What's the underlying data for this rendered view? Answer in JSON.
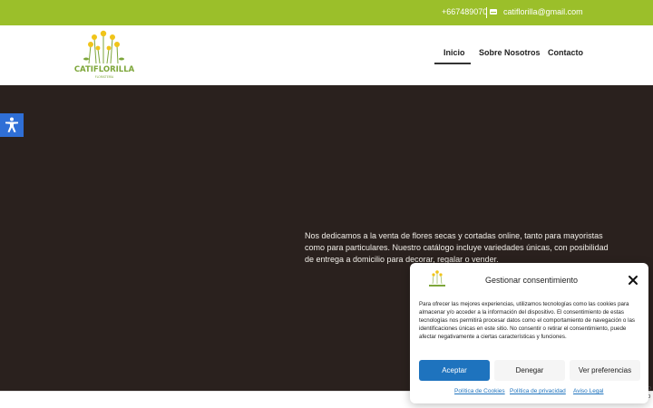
{
  "topbar": {
    "phone": "+667489070",
    "email": "catiflorilla@gmail.com",
    "bg_color": "#9bbf2a"
  },
  "header": {
    "logo_text": "CATIFLORILLA",
    "logo_subtext": "FLORISTERÍA",
    "nav": [
      {
        "label": "Inicio",
        "active": true
      },
      {
        "label": "Sobre Nosotros",
        "active": false
      },
      {
        "label": "Contacto",
        "active": false
      }
    ]
  },
  "hero": {
    "text": "Nos dedicamos a la venta de flores secas y cortadas online, tanto para mayoristas como para particulares. Nuestro catálogo incluye variedades únicas, con posibilidad de entrega a domicilio para decorar, regalar o vender.",
    "bg_color": "#2a211e"
  },
  "accessibility": {
    "icon": "accessibility-icon",
    "color": "#2f6fd6"
  },
  "consent": {
    "title": "Gestionar consentimiento",
    "body": "Para ofrecer las mejores experiencias, utilizamos tecnologías como las cookies para almacenar y/o acceder a la información del dispositivo. El consentimiento de estas tecnologías nos permitirá procesar datos como el comportamiento de navegación o las identificaciones únicas en este sitio. No consentir o retirar el consentimiento, puede afectar negativamente a ciertas características y funciones.",
    "accept_label": "Aceptar",
    "deny_label": "Denegar",
    "prefs_label": "Ver preferencias",
    "links": [
      "Política de Cookies",
      "Política de privacidad",
      "Aviso Legal"
    ],
    "accent_color": "#1e73be"
  },
  "recaptcha": {
    "partial_text_1": "fo",
    "partial_text_2": "lo"
  }
}
